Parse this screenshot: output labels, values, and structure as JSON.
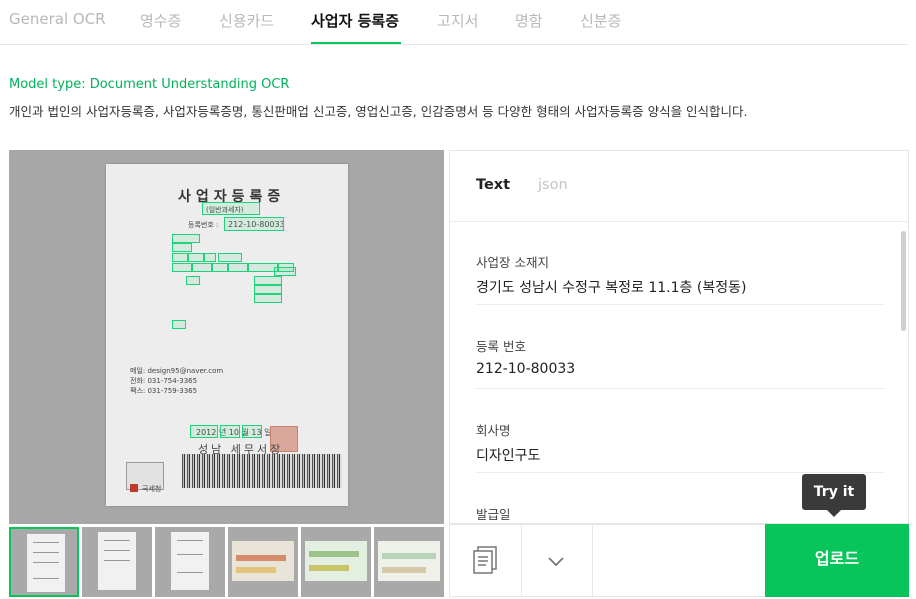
{
  "tabs": [
    {
      "label": "General OCR"
    },
    {
      "label": "영수증"
    },
    {
      "label": "신용카드"
    },
    {
      "label": "사업자 등록증"
    },
    {
      "label": "고지서"
    },
    {
      "label": "명함"
    },
    {
      "label": "신분증"
    }
  ],
  "active_tab": "사업자 등록증",
  "model_type": "Model type: Document Understanding OCR",
  "description": "개인과 법인의 사업자등록증, 사업자등록증명, 통신판매업 신고증, 영업신고증, 인감증명서 등 다양한 형태의 사업자등록증 양식을 인식합니다.",
  "document": {
    "title": "사업자등록증",
    "subtitle": "(일반과세자)",
    "reg_label": "등록번호 :",
    "reg_number": "212-10-80033",
    "email": "메일: design95@naver.com",
    "phone": "전화: 031-754-3365",
    "fax": "팩스: 031-759-3365",
    "date": "2012 년   10 월   13 일",
    "office": "성남 세무서장",
    "logo": "국세청"
  },
  "result_tabs": {
    "text": "Text",
    "json": "json"
  },
  "fields": [
    {
      "label": "사업장 소재지",
      "value": "경기도 성남시 수정구 복정로 11.1층 (복정동)"
    },
    {
      "label": "등록 번호",
      "value": "212-10-80033"
    },
    {
      "label": "회사명",
      "value": "디자인구도"
    },
    {
      "label": "발급일",
      "value": ""
    }
  ],
  "tooltip": "Try it",
  "upload_label": "업로드",
  "icons": {
    "document": "document-icon",
    "chevron": "chevron-down-icon"
  },
  "colors": {
    "accent": "#03c75a",
    "tooltip_bg": "#3a3a3a"
  }
}
